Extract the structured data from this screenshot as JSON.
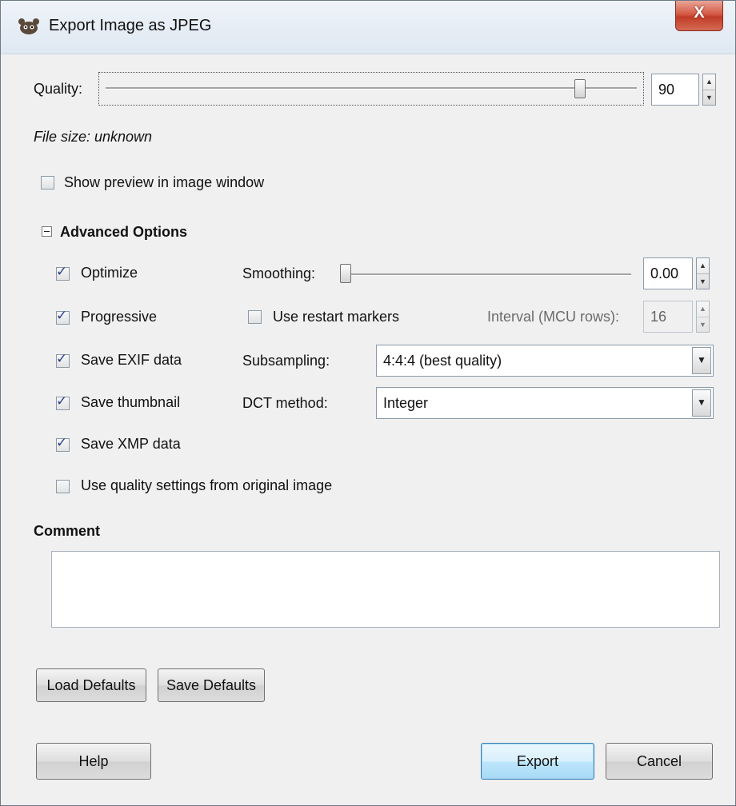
{
  "window": {
    "title": "Export Image as JPEG",
    "close_label": "X"
  },
  "quality": {
    "label": "Quality:",
    "value": "90",
    "slider_fraction": 0.9
  },
  "file_size": "File size: unknown",
  "show_preview": {
    "label": "Show preview in image window",
    "checked": false
  },
  "advanced": {
    "header": "Advanced Options",
    "optimize": {
      "label": "Optimize",
      "checked": true
    },
    "progressive": {
      "label": "Progressive",
      "checked": true
    },
    "save_exif": {
      "label": "Save EXIF data",
      "checked": true
    },
    "save_thumbnail": {
      "label": "Save thumbnail",
      "checked": true
    },
    "save_xmp": {
      "label": "Save XMP data",
      "checked": true
    },
    "use_quality_original": {
      "label": "Use quality settings from original image",
      "checked": false
    },
    "smoothing": {
      "label": "Smoothing:",
      "value": "0.00",
      "slider_fraction": 0.0
    },
    "restart_markers": {
      "label": "Use restart markers",
      "checked": false
    },
    "interval": {
      "label": "Interval (MCU rows):",
      "value": "16"
    },
    "subsampling": {
      "label": "Subsampling:",
      "selected": "4:4:4 (best quality)"
    },
    "dct_method": {
      "label": "DCT method:",
      "selected": "Integer"
    }
  },
  "comment": {
    "label": "Comment",
    "value": ""
  },
  "buttons": {
    "load_defaults": "Load Defaults",
    "save_defaults": "Save Defaults",
    "help": "Help",
    "export": "Export",
    "cancel": "Cancel"
  },
  "colors": {
    "window_bg": "#f0f0f0",
    "close_button": "#c13c27",
    "default_button_border": "#3c7fb1"
  }
}
